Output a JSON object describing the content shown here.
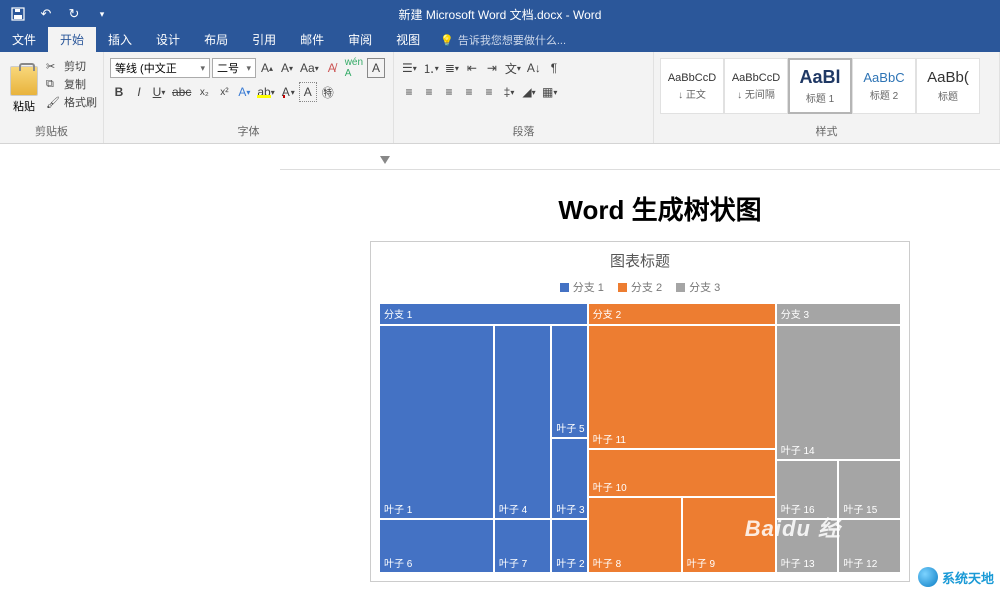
{
  "titlebar": {
    "title": "新建 Microsoft Word 文档.docx - Word"
  },
  "tabs": {
    "file": "文件",
    "home": "开始",
    "insert": "插入",
    "design": "设计",
    "layout": "布局",
    "references": "引用",
    "mailings": "邮件",
    "review": "审阅",
    "view": "视图",
    "tellme": "告诉我您想要做什么..."
  },
  "clipboard": {
    "paste": "粘贴",
    "cut": "剪切",
    "copy": "复制",
    "painter": "格式刷",
    "label": "剪贴板"
  },
  "font": {
    "name": "等线 (中文正",
    "size": "二号",
    "label": "字体"
  },
  "paragraph": {
    "label": "段落"
  },
  "styles": {
    "label": "样式",
    "items": [
      {
        "preview": "AaBbCcD",
        "name": "↓ 正文"
      },
      {
        "preview": "AaBbCcD",
        "name": "↓ 无间隔"
      },
      {
        "preview": "AaBl",
        "name": "标题 1"
      },
      {
        "preview": "AaBbC",
        "name": "标题 2"
      },
      {
        "preview": "AaBb(",
        "name": "标题"
      }
    ]
  },
  "document": {
    "heading": "Word 生成树状图"
  },
  "chart_data": {
    "type": "treemap",
    "title": "图表标题",
    "legend": [
      "分支 1",
      "分支 2",
      "分支 3"
    ],
    "colors": {
      "分支 1": "#4472c4",
      "分支 2": "#ed7d31",
      "分支 3": "#a5a5a5"
    },
    "series": [
      {
        "branch": "分支 1",
        "leaves": [
          "叶子 1",
          "叶子 6",
          "叶子 4",
          "叶子 7",
          "叶子 5",
          "叶子 3",
          "叶子 2"
        ]
      },
      {
        "branch": "分支 2",
        "leaves": [
          "叶子 11",
          "叶子 10",
          "叶子 8",
          "叶子 9"
        ]
      },
      {
        "branch": "分支 3",
        "leaves": [
          "叶子 14",
          "叶子 16",
          "叶子 15",
          "叶子 13",
          "叶子 12"
        ]
      }
    ]
  },
  "watermark": "Baidu 经",
  "corner": "系统天地"
}
